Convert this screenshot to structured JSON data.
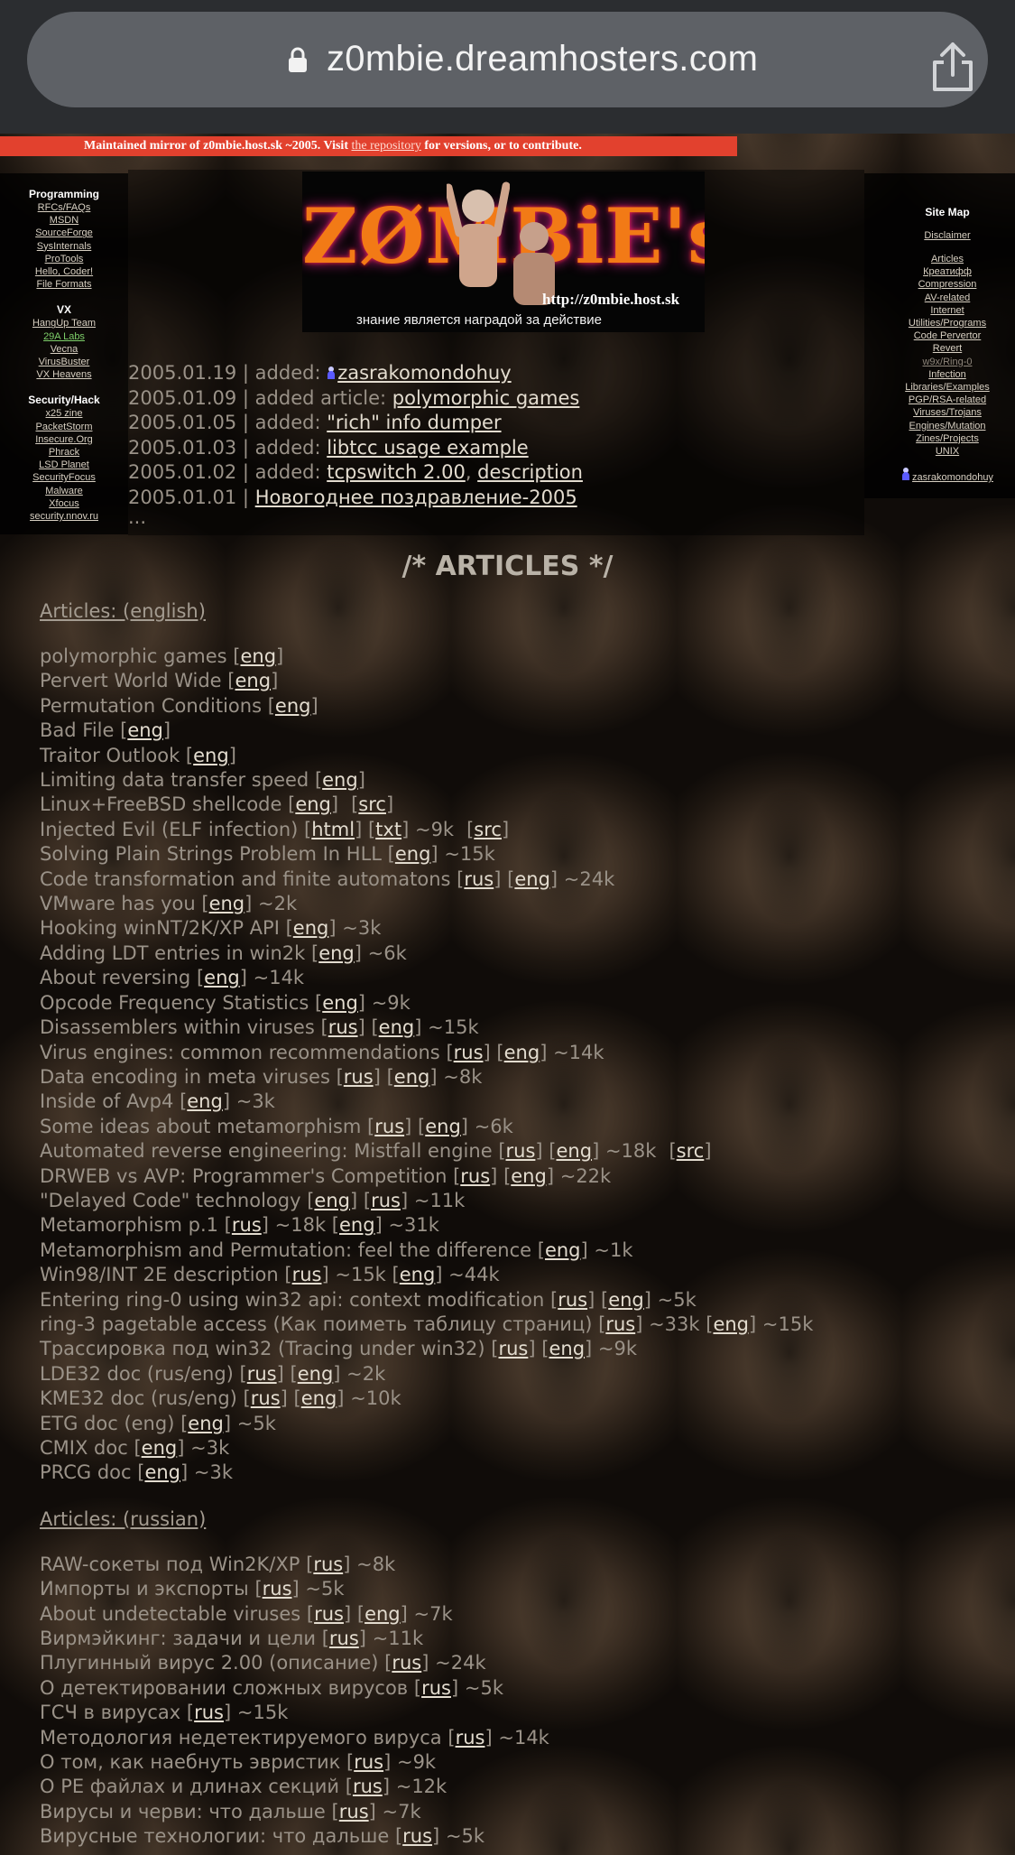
{
  "browser": {
    "url": "z0mbie.dreamhosters.com",
    "lock_icon": "lock-icon",
    "share_icon": "share-icon"
  },
  "banner": {
    "text_before": "Maintained mirror of z0mbie.host.sk ~2005. Visit ",
    "link": "the repository",
    "text_after": " for versions, or to contribute.",
    "color": "#e2412e"
  },
  "left_menu": {
    "sections": [
      {
        "title": "Programming",
        "items": [
          "RFCs/FAQs",
          "MSDN",
          "SourceForge",
          "SysInternals",
          "ProTools",
          "Hello, Coder!",
          "File Formats"
        ]
      },
      {
        "title": "VX",
        "items": [
          "HangUp Team",
          "29A Labs",
          "Vecna",
          "VirusBuster",
          "VX Heavens"
        ]
      },
      {
        "title": "Security/Hack",
        "items": [
          "x25 zine",
          "PacketStorm",
          "Insecure.Org",
          "Phrack",
          "LSD Planet",
          "SecurityFocus",
          "Malware",
          "Xfocus",
          "security.nnov.ru"
        ]
      }
    ]
  },
  "right_menu": {
    "title": "Site Map",
    "disclaimer": "Disclaimer",
    "items": [
      "Articles",
      "Креатифф",
      "Compression",
      "AV-related",
      "Internet",
      "Utilities/Programs",
      "Code Pervertor",
      "Revert",
      "w9x/Ring-0",
      "Infection",
      "Libraries/Examples",
      "PGP/RSA-related",
      "Viruses/Trojans",
      "Engines/Mutation",
      "Zines/Projects",
      "UNIX"
    ],
    "user": "zasrakomondohuy"
  },
  "logo": {
    "title": "ZØMBiE's",
    "url": "http://z0mbie.host.sk",
    "motto": "знание является наградой за действие"
  },
  "news": [
    {
      "date": "2005.01.19",
      "prefix": " | added: ",
      "links": [
        "zasrakomondohuy"
      ],
      "icon": true
    },
    {
      "date": "2005.01.09",
      "prefix": " | added article: ",
      "links": [
        "polymorphic games"
      ]
    },
    {
      "date": "2005.01.05",
      "prefix": " | added: ",
      "links": [
        "\"rich\" info dumper"
      ]
    },
    {
      "date": "2005.01.03",
      "prefix": " | added: ",
      "links": [
        "libtcc usage example"
      ]
    },
    {
      "date": "2005.01.02",
      "prefix": " | added: ",
      "links": [
        "tcpswitch 2.00",
        "description"
      ]
    },
    {
      "date": "2005.01.01",
      "prefix": " | ",
      "links": [
        "Новогоднее поздравление-2005"
      ]
    }
  ],
  "news_more": "...",
  "articles_heading": "/* ARTICLES */",
  "categories": [
    {
      "title": "Articles: (english)",
      "items": [
        {
          "t": "polymorphic games",
          "l": [
            "eng"
          ]
        },
        {
          "t": "Pervert World Wide",
          "l": [
            "eng"
          ]
        },
        {
          "t": "Permutation Conditions",
          "l": [
            "eng"
          ]
        },
        {
          "t": "Bad File",
          "l": [
            "eng"
          ]
        },
        {
          "t": "Traitor Outlook",
          "l": [
            "eng"
          ]
        },
        {
          "t": "Limiting data transfer speed",
          "l": [
            "eng"
          ]
        },
        {
          "t": "Linux+FreeBSD shellcode",
          "l": [
            "eng"
          ],
          "src": true
        },
        {
          "t": "Injected Evil (ELF infection)",
          "l": [
            "html",
            "txt"
          ],
          "s": "~9k",
          "src": true
        },
        {
          "t": "Solving Plain Strings Problem In HLL",
          "l": [
            "eng"
          ],
          "s": "~15k"
        },
        {
          "t": "Code transformation and finite automatons",
          "l": [
            "rus",
            "eng"
          ],
          "s": "~24k"
        },
        {
          "t": "VMware has you",
          "l": [
            "eng"
          ],
          "s": "~2k"
        },
        {
          "t": "Hooking winNT/2K/XP API",
          "l": [
            "eng"
          ],
          "s": "~3k"
        },
        {
          "t": "Adding LDT entries in win2k",
          "l": [
            "eng"
          ],
          "s": "~6k"
        },
        {
          "t": "About reversing",
          "l": [
            "eng"
          ],
          "s": "~14k"
        },
        {
          "t": "Opcode Frequency Statistics",
          "l": [
            "eng"
          ],
          "s": "~9k"
        },
        {
          "t": "Disassemblers within viruses",
          "l": [
            "rus",
            "eng"
          ],
          "s": "~15k"
        },
        {
          "t": "Virus engines: common recommendations",
          "l": [
            "rus",
            "eng"
          ],
          "s": "~14k"
        },
        {
          "t": "Data encoding in meta viruses",
          "l": [
            "rus",
            "eng"
          ],
          "s": "~8k"
        },
        {
          "t": "Inside of Avp4",
          "l": [
            "eng"
          ],
          "s": "~3k"
        },
        {
          "t": "Some ideas about metamorphism",
          "l": [
            "rus",
            "eng"
          ],
          "s": "~6k"
        },
        {
          "t": "Automated reverse engineering: Mistfall engine",
          "l": [
            "rus",
            "eng"
          ],
          "s": "~18k",
          "src": true
        },
        {
          "t": "DRWEB vs AVP: Programmer's Competition",
          "l": [
            "rus",
            "eng"
          ],
          "s": "~22k"
        },
        {
          "t": "\"Delayed Code\" technology",
          "l": [
            "eng",
            "rus"
          ],
          "s": "~11k"
        },
        {
          "t": "Metamorphism p.1",
          "mixed": [
            [
              "rus",
              "~18k"
            ],
            [
              "eng",
              "~31k"
            ]
          ]
        },
        {
          "t": "Metamorphism and Permutation: feel the difference",
          "l": [
            "eng"
          ],
          "s": "~1k"
        },
        {
          "t": "Win98/INT 2E description",
          "mixed": [
            [
              "rus",
              "~15k"
            ],
            [
              "eng",
              "~44k"
            ]
          ]
        },
        {
          "t": "Entering ring-0 using win32 api: context modification",
          "l": [
            "rus",
            "eng"
          ],
          "s": "~5k"
        },
        {
          "t": "ring-3 pagetable access (Как поиметь таблицу страниц)",
          "mixed": [
            [
              "rus",
              "~33k"
            ],
            [
              "eng",
              "~15k"
            ]
          ]
        },
        {
          "t": "Трассировка под win32 (Tracing under win32)",
          "l": [
            "rus",
            "eng"
          ],
          "s": "~9k"
        },
        {
          "t": "LDE32 doc (rus/eng)",
          "l": [
            "rus",
            "eng"
          ],
          "s": "~2k"
        },
        {
          "t": "KME32 doc (rus/eng)",
          "l": [
            "rus",
            "eng"
          ],
          "s": "~10k"
        },
        {
          "t": "ETG doc (eng)",
          "l": [
            "eng"
          ],
          "s": "~5k"
        },
        {
          "t": "CMIX doc",
          "l": [
            "eng"
          ],
          "s": "~3k"
        },
        {
          "t": "PRCG doc",
          "l": [
            "eng"
          ],
          "s": "~3k"
        }
      ]
    },
    {
      "title": "Articles: (russian)",
      "items": [
        {
          "t": "RAW-сокеты под Win2K/XP",
          "l": [
            "rus"
          ],
          "s": "~8k"
        },
        {
          "t": "Импорты и экспорты",
          "l": [
            "rus"
          ],
          "s": "~5k"
        },
        {
          "t": "About undetectable viruses",
          "l": [
            "rus",
            "eng"
          ],
          "s": "~7k"
        },
        {
          "t": "Вирмэйкинг: задачи и цели",
          "l": [
            "rus"
          ],
          "s": "~11k"
        },
        {
          "t": "Плугинный вирус 2.00 (описание)",
          "l": [
            "rus"
          ],
          "s": "~24k"
        },
        {
          "t": "О детектировании сложных вирусов",
          "l": [
            "rus"
          ],
          "s": "~5k"
        },
        {
          "t": "ГСЧ в вирусах",
          "l": [
            "rus"
          ],
          "s": "~15k"
        },
        {
          "t": "Методология недетектируемого вируса",
          "l": [
            "rus"
          ],
          "s": "~14k"
        },
        {
          "t": "О том, как наебнуть эвристик",
          "l": [
            "rus"
          ],
          "s": "~9k"
        },
        {
          "t": "О PE файлах и длинах секций",
          "l": [
            "rus"
          ],
          "s": "~12k"
        },
        {
          "t": "Вирусы и черви: что дальше",
          "l": [
            "rus"
          ],
          "s": "~7k"
        },
        {
          "t": "Вирусные технологии: что дальше",
          "l": [
            "rus"
          ],
          "s": "~5k"
        }
      ]
    }
  ],
  "src_label": "src"
}
